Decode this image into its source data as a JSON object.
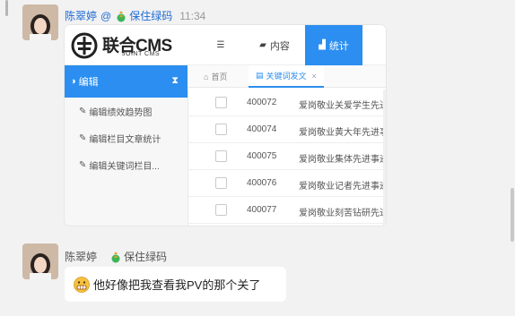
{
  "message1": {
    "sender": "陈翠婷",
    "at_sign": "@",
    "lucky_label": "保住绿码",
    "time": "11:34"
  },
  "cms": {
    "brand": "联合CMS",
    "brand_sub": "JOINT CMS",
    "nav": [
      {
        "label": "",
        "icon": "menu-icon"
      },
      {
        "label": "内容",
        "icon": "book-icon"
      },
      {
        "label": "统计",
        "icon": "chart-icon"
      }
    ],
    "sidebar_header": "编辑",
    "sidebar_items": [
      "编辑绩效趋势图",
      "编辑栏目文章统计",
      "编辑关键词栏目..."
    ],
    "tabs": {
      "home": "首页",
      "active": "关键词发文",
      "close": "×"
    },
    "rows": [
      {
        "id": "400072",
        "title": "爱岗敬业关爱学生先进"
      },
      {
        "id": "400074",
        "title": "爱岗敬业黄大年先进事"
      },
      {
        "id": "400075",
        "title": "爱岗敬业集体先进事迹"
      },
      {
        "id": "400076",
        "title": "爱岗敬业记者先进事迹"
      },
      {
        "id": "400077",
        "title": "爱岗敬业刻苦钻研先进"
      }
    ]
  },
  "message2": {
    "sender": "陈翠婷",
    "lucky_label": "保住绿码",
    "text": "他好像把我查看我PV的那个关了"
  },
  "colors": {
    "accent": "#2b8ef0",
    "link": "#1e6bd6"
  }
}
